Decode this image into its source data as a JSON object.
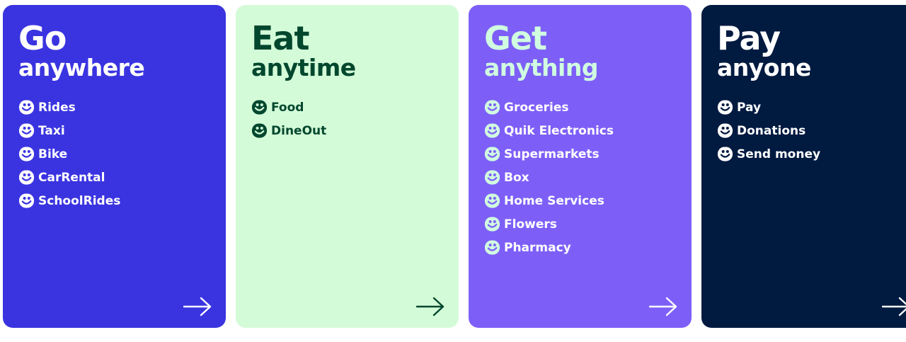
{
  "cards": [
    {
      "title": "Go",
      "subtitle": "anywhere",
      "colors": {
        "background": "#3A34E0",
        "title": "#FFFFFF",
        "items": "#FFFFFF",
        "icon": "#FFFFFF",
        "icon_face": "#3A34E0",
        "arrow": "#FFFFFF"
      },
      "items": [
        "Rides",
        "Taxi",
        "Bike",
        "CarRental",
        "SchoolRides"
      ]
    },
    {
      "title": "Eat",
      "subtitle": "anytime",
      "colors": {
        "background": "#D4FBD8",
        "title": "#00472E",
        "items": "#00472E",
        "icon": "#00472E",
        "icon_face": "#D4FBD8",
        "arrow": "#00472E"
      },
      "items": [
        "Food",
        "DineOut"
      ]
    },
    {
      "title": "Get",
      "subtitle": "anything",
      "colors": {
        "background": "#7D5FF7",
        "title": "#D0FCE0",
        "items": "#FFFFFF",
        "icon": "#D0FCE0",
        "icon_face": "#7D5FF7",
        "arrow": "#FFFFFF"
      },
      "items": [
        "Groceries",
        "Quik Electronics",
        "Supermarkets",
        "Box",
        "Home Services",
        "Flowers",
        "Pharmacy"
      ]
    },
    {
      "title": "Pay",
      "subtitle": "anyone",
      "colors": {
        "background": "#001A40",
        "title": "#FFFFFF",
        "items": "#FFFFFF",
        "icon": "#FFFFFF",
        "icon_face": "#001A40",
        "arrow": "#FFFFFF"
      },
      "items": [
        "Pay",
        "Donations",
        "Send money"
      ]
    }
  ],
  "icons": {
    "item": "smiley-face-icon",
    "next": "arrow-right-icon"
  }
}
